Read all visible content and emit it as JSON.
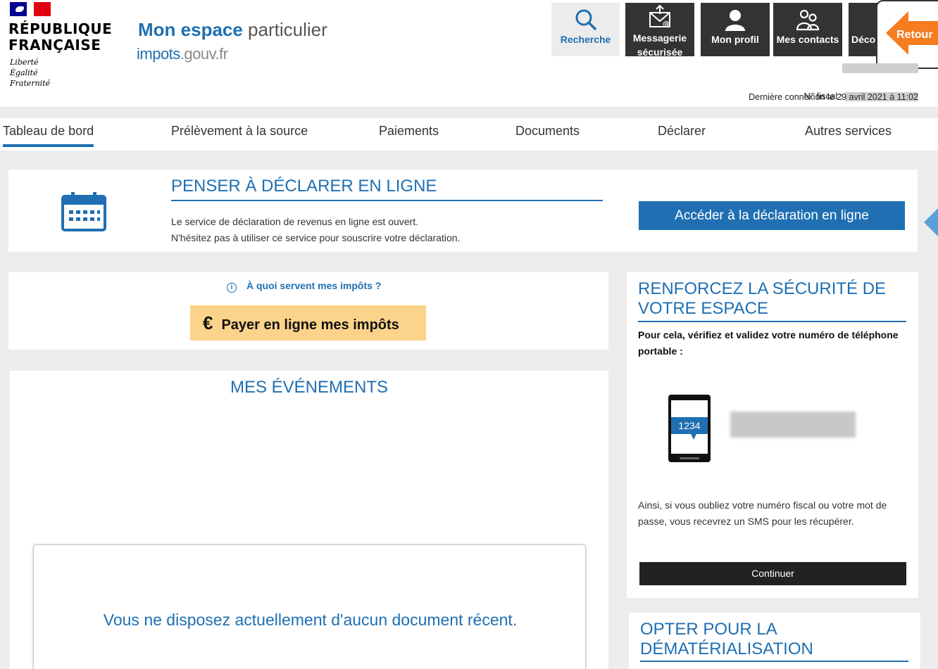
{
  "republique": {
    "title_line1": "RÉPUBLIQUE",
    "title_line2": "FRANÇAISE",
    "motto": [
      "Liberté",
      "Égalité",
      "Fraternité"
    ]
  },
  "brand": {
    "title_a": "Mon espace",
    "title_b": " particulier",
    "site_a": "impots",
    "site_b": ".gouv.fr"
  },
  "toolbar": {
    "search": "Recherche",
    "messagerie_line1": "Messagerie",
    "messagerie_line2": "sécurisée",
    "profil": "Mon profil",
    "contacts": "Mes contacts",
    "deconnexion": "Déco",
    "retour": "Retour"
  },
  "account": {
    "fiscal_label": "N° fiscal :",
    "last_connection": "Dernière connexion le 29 avril 2021 à 11:02"
  },
  "nav": {
    "items": [
      "Tableau de bord",
      "Prélèvement à la source",
      "Paiements",
      "Documents",
      "Déclarer",
      "Autres services"
    ],
    "active": "Tableau de bord"
  },
  "declare": {
    "title": "PENSER À DÉCLARER EN LIGNE",
    "line1": "Le service de déclaration de revenus en ligne est ouvert.",
    "line2": "N'hésitez pas à utiliser ce service pour souscrire votre déclaration.",
    "button": "Accéder à la déclaration en ligne"
  },
  "payer": {
    "info_link": "À quoi servent mes impôts ?",
    "button": "Payer en ligne mes impôts",
    "currency_symbol": "€"
  },
  "events": {
    "title": "MES ÉVÉNEMENTS",
    "empty": "Vous ne disposez actuellement d'aucun document récent."
  },
  "security": {
    "title": "RENFORCEZ LA SÉCURITÉ DE VOTRE ESPACE",
    "subtitle": "Pour cela, vérifiez et validez votre numéro de téléphone portable :",
    "phone_code": "1234",
    "text": "Ainsi, si vous oubliez votre numéro fiscal ou votre mot de passe, vous recevrez un SMS pour les récupérer.",
    "button": "Continuer"
  },
  "demat": {
    "title": "OPTER POUR LA DÉMATÉRIALISATION"
  },
  "colors": {
    "primary": "#1f6fb2",
    "pay_button": "#fbd38a",
    "dark_button": "#222222",
    "retour_orange": "#f57c1f"
  }
}
